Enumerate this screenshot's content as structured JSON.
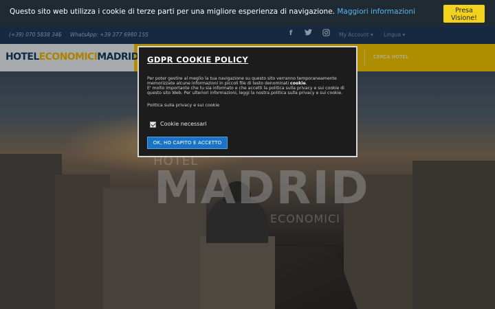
{
  "cookie_banner": {
    "message": "Questo sito web utilizza i cookie di terze parti per una migliore esperienza di navigazione.",
    "link": "Maggiori informazioni",
    "accept_line1": "Presa",
    "accept_line2": "Visione!"
  },
  "topbar": {
    "phone": "(+39) 070 5838 346",
    "separator": "|",
    "whatsapp": "WhatsApp: +39 377 6980 155",
    "account": "My Account ▾",
    "lingua": "Lingua ▾",
    "social_icons": [
      "facebook-icon",
      "twitter-icon",
      "instagram-icon"
    ]
  },
  "navbar": {
    "logo_part1": "HOTEL",
    "logo_part2": "ECONOMICI",
    "logo_part3": "MADRID",
    "cerca": "CERCA HOTEL"
  },
  "hero": {
    "line1": "HOTEL",
    "line2": "MADRID",
    "line3": "ECONOMICI"
  },
  "modal": {
    "title": "GDPR COOKIE POLICY",
    "body_part1": "Per poter gestire al meglio la tua navigazione su questo sito verranno temporaneamente memorizzate alcune informazioni in piccoli file di testo denominati ",
    "body_bold": "cookie",
    "body_part2": "E' molto importante che tu sia informato e che accetti la politica sulla privacy e sui cookie di questo sito Web. Per ulteriori informazioni, leggi la nostra politica sulla privacy e sui cookie.",
    "privacy_link": "Politica sulla privacy e sui cookie",
    "checkbox_label": "Cookie necessari",
    "checkbox_checked": true,
    "button": "OK, HO CAPITO E ACCETTO"
  },
  "colors": {
    "banner_bg": "#1f2a33",
    "topbar_bg": "#1f3a5a",
    "navbar_yellow": "#f3c400",
    "accept_yellow": "#f2d21a",
    "modal_bg": "#1c1c1c",
    "button_blue": "#1a73c7",
    "link_blue": "#5bb4f0"
  }
}
